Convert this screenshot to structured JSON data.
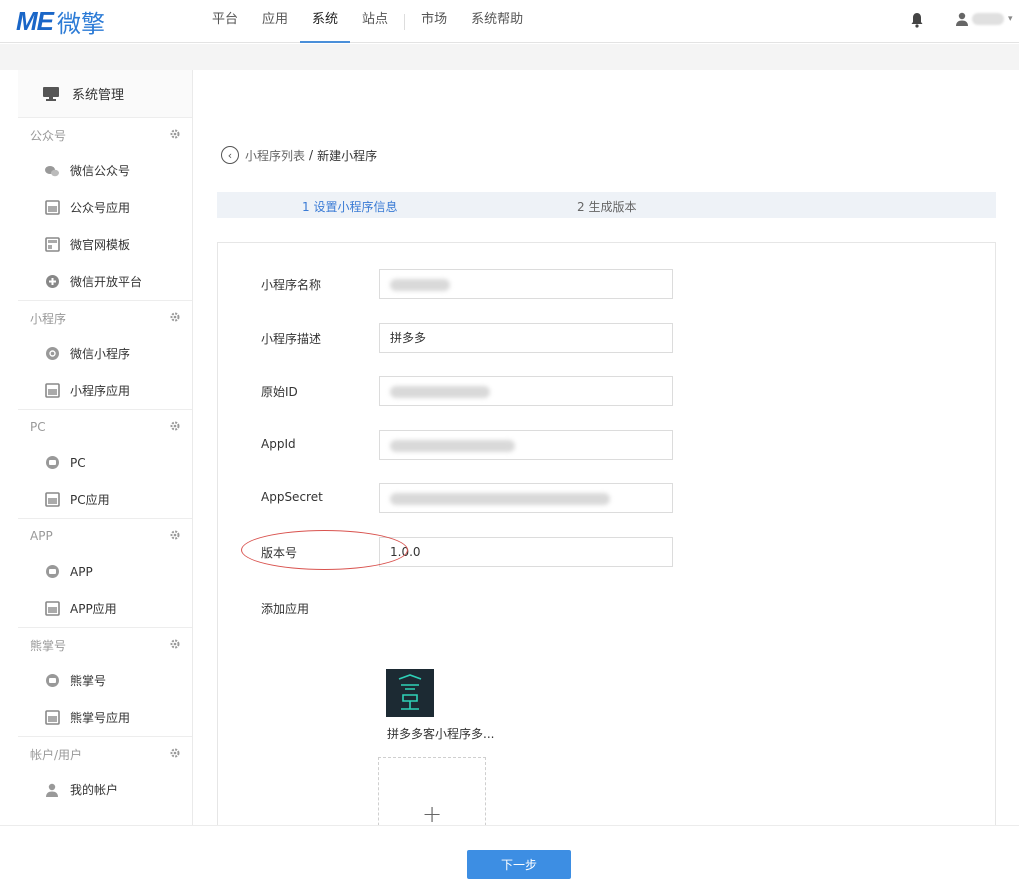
{
  "app": {
    "logo_main": "ME",
    "logo_cn": "微擎"
  },
  "nav": {
    "items": [
      "平台",
      "应用",
      "系统",
      "站点",
      "市场",
      "系统帮助"
    ],
    "active": "系统"
  },
  "sidebar": {
    "header": "系统管理",
    "groups": [
      {
        "title": "公众号",
        "items": [
          "微信公众号",
          "公众号应用",
          "微官网模板",
          "微信开放平台"
        ]
      },
      {
        "title": "小程序",
        "items": [
          "微信小程序",
          "小程序应用"
        ]
      },
      {
        "title": "PC",
        "items": [
          "PC",
          "PC应用"
        ]
      },
      {
        "title": "APP",
        "items": [
          "APP",
          "APP应用"
        ]
      },
      {
        "title": "熊掌号",
        "items": [
          "熊掌号",
          "熊掌号应用"
        ]
      },
      {
        "title": "帐户/用户",
        "items": [
          "我的帐户"
        ]
      }
    ]
  },
  "breadcrumb": {
    "parent": "小程序列表",
    "separator": "/",
    "current": "新建小程序"
  },
  "steps": {
    "step1": "1 设置小程序信息",
    "step2": "2 生成版本"
  },
  "form": {
    "name_label": "小程序名称",
    "desc_label": "小程序描述",
    "desc_value": "拼多多",
    "original_id_label": "原始ID",
    "appid_label": "AppId",
    "appsecret_label": "AppSecret",
    "version_label": "版本号",
    "version_value": "1.0.0",
    "add_app_label": "添加应用",
    "app_name": "拼多多客小程序多..."
  },
  "footer": {
    "next_label": "下一步"
  },
  "colors": {
    "brand": "#1a66c7",
    "accent": "#3d8ee3",
    "highlight_oval": "#d9534f"
  }
}
